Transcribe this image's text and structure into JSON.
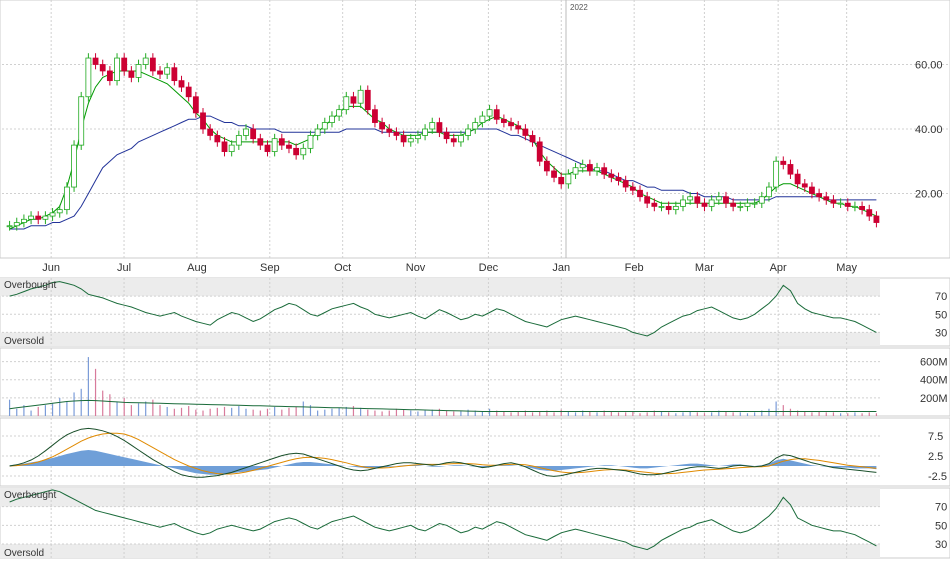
{
  "chart_data": [
    {
      "type": "candlestick",
      "year_label": "2022",
      "x_labels": [
        "Jun",
        "Jul",
        "Aug",
        "Sep",
        "Oct",
        "Nov",
        "Dec",
        "Jan",
        "Feb",
        "Mar",
        "Apr",
        "May"
      ],
      "y_ticks": [
        "60.00",
        "40.00",
        "20.00"
      ],
      "y_tick_values": [
        60,
        40,
        20
      ],
      "ylim": [
        0,
        80
      ],
      "grid": true,
      "colors": {
        "up": "#22aa22",
        "down": "#cc0033",
        "ma_short": "#009900",
        "ma_long": "#223399"
      },
      "closes": [
        10,
        11,
        12,
        13,
        12,
        13,
        14,
        15,
        22,
        35,
        50,
        62,
        60,
        58,
        55,
        62,
        58,
        56,
        60,
        62,
        58,
        57,
        59,
        55,
        53,
        50,
        45,
        40,
        38,
        36,
        33,
        35,
        38,
        40,
        37,
        35,
        33,
        37,
        35,
        34,
        32,
        34,
        38,
        40,
        42,
        44,
        46,
        50,
        48,
        52,
        46,
        42,
        40,
        39,
        38,
        36,
        37,
        38,
        40,
        42,
        39,
        37,
        36,
        38,
        40,
        42,
        44,
        46,
        43,
        42,
        41,
        40,
        38,
        36,
        30,
        27,
        25,
        23,
        26,
        28,
        29,
        27,
        28,
        26,
        25,
        24,
        22,
        21,
        19,
        17,
        16,
        16,
        15,
        16,
        18,
        19,
        17,
        16,
        18,
        19,
        17,
        16,
        16,
        17,
        17,
        19,
        22,
        30,
        29,
        26,
        23,
        22,
        20,
        19,
        18,
        17,
        17,
        16,
        16,
        15,
        13,
        11
      ],
      "ma_short": [
        9,
        10,
        11,
        12,
        12,
        13,
        14,
        16,
        22,
        30,
        40,
        48,
        53,
        56,
        57,
        58,
        58,
        58,
        58,
        57,
        56,
        55,
        54,
        52,
        50,
        48,
        45,
        43,
        40,
        38,
        37,
        36,
        36,
        36,
        36,
        36,
        36,
        36,
        36,
        36,
        35,
        36,
        37,
        39,
        41,
        43,
        45,
        47,
        47,
        47,
        45,
        43,
        42,
        40,
        39,
        38,
        38,
        38,
        39,
        39,
        39,
        38,
        38,
        38,
        39,
        40,
        42,
        43,
        44,
        43,
        42,
        41,
        39,
        37,
        33,
        30,
        28,
        26,
        26,
        27,
        27,
        27,
        27,
        26,
        25,
        24,
        23,
        22,
        20,
        19,
        18,
        17,
        17,
        17,
        17,
        17,
        17,
        17,
        17,
        17,
        17,
        17,
        17,
        17,
        17,
        18,
        20,
        22,
        23,
        23,
        22,
        21,
        20,
        19,
        18,
        17,
        17,
        16,
        16,
        15,
        14,
        13
      ],
      "ma_long": [
        9,
        9,
        9,
        10,
        10,
        10,
        11,
        11,
        12,
        13,
        16,
        20,
        24,
        28,
        30,
        32,
        33,
        34,
        36,
        37,
        38,
        39,
        40,
        41,
        42,
        43,
        43,
        44,
        44,
        43,
        42,
        42,
        41,
        41,
        40,
        40,
        40,
        40,
        39,
        39,
        39,
        39,
        39,
        39,
        39,
        39,
        39,
        40,
        40,
        40,
        40,
        40,
        39,
        39,
        39,
        39,
        39,
        39,
        39,
        39,
        39,
        39,
        39,
        39,
        39,
        40,
        40,
        40,
        40,
        39,
        38,
        38,
        37,
        36,
        35,
        34,
        33,
        32,
        31,
        30,
        29,
        28,
        27,
        27,
        26,
        25,
        24,
        24,
        23,
        22,
        22,
        21,
        21,
        21,
        21,
        20,
        20,
        19,
        19,
        19,
        19,
        18,
        18,
        18,
        18,
        18,
        18,
        19,
        19,
        19,
        19,
        19,
        19,
        19,
        18,
        18,
        18,
        18,
        18,
        18,
        18,
        18
      ]
    },
    {
      "type": "line",
      "panel": "RSI",
      "labels_top": "Overbought",
      "labels_bottom": "Oversold",
      "y_ticks": [
        "70",
        "50",
        "30"
      ],
      "ylim": [
        15,
        90
      ],
      "values": [
        70,
        72,
        75,
        78,
        80,
        82,
        85,
        86,
        84,
        82,
        78,
        72,
        70,
        68,
        65,
        62,
        60,
        58,
        55,
        52,
        50,
        48,
        50,
        52,
        48,
        45,
        42,
        40,
        38,
        44,
        48,
        52,
        50,
        46,
        42,
        45,
        50,
        55,
        58,
        62,
        60,
        55,
        50,
        48,
        52,
        56,
        58,
        60,
        62,
        58,
        55,
        50,
        48,
        46,
        48,
        50,
        52,
        48,
        45,
        50,
        55,
        52,
        48,
        44,
        46,
        50,
        48,
        52,
        56,
        54,
        50,
        46,
        42,
        40,
        38,
        36,
        40,
        44,
        46,
        48,
        46,
        44,
        42,
        40,
        38,
        36,
        34,
        30,
        28,
        26,
        30,
        36,
        40,
        44,
        48,
        50,
        54,
        56,
        58,
        54,
        50,
        46,
        44,
        46,
        50,
        56,
        62,
        70,
        82,
        76,
        62,
        56,
        52,
        50,
        48,
        46,
        46,
        44,
        42,
        38,
        34,
        30
      ]
    },
    {
      "type": "bar",
      "panel": "Volume",
      "y_ticks": [
        "600M",
        "400M",
        "200M"
      ],
      "ylim": [
        0,
        750
      ],
      "values": [
        180,
        80,
        120,
        60,
        100,
        120,
        140,
        200,
        160,
        260,
        300,
        650,
        520,
        280,
        240,
        160,
        200,
        120,
        140,
        160,
        180,
        120,
        100,
        80,
        90,
        110,
        70,
        60,
        80,
        90,
        100,
        90,
        110,
        80,
        70,
        60,
        80,
        100,
        70,
        90,
        100,
        160,
        120,
        60,
        70,
        80,
        90,
        100,
        110,
        90,
        70,
        60,
        50,
        60,
        80,
        70,
        60,
        50,
        60,
        70,
        80,
        60,
        50,
        60,
        70,
        60,
        50,
        80,
        60,
        50,
        40,
        50,
        60,
        40,
        50,
        60,
        40,
        70,
        50,
        40,
        60,
        50,
        40,
        60,
        50,
        40,
        40,
        50,
        30,
        40,
        60,
        50,
        40,
        30,
        40,
        50,
        40,
        30,
        40,
        60,
        50,
        40,
        40,
        30,
        40,
        60,
        80,
        160,
        120,
        80,
        60,
        50,
        40,
        50,
        40,
        40,
        30,
        30,
        40,
        30,
        40,
        30
      ],
      "avg_line": [
        80,
        90,
        100,
        110,
        120,
        130,
        140,
        150,
        160,
        165,
        170,
        172,
        170,
        165,
        160,
        155,
        150,
        148,
        146,
        144,
        142,
        140,
        138,
        136,
        134,
        132,
        130,
        128,
        126,
        124,
        122,
        120,
        118,
        116,
        114,
        112,
        110,
        108,
        106,
        104,
        102,
        100,
        98,
        96,
        94,
        92,
        90,
        88,
        86,
        84,
        82,
        80,
        78,
        76,
        74,
        72,
        70,
        68,
        66,
        64,
        62,
        60,
        58,
        56,
        54,
        52,
        50,
        50,
        50,
        50,
        50,
        50,
        50,
        50,
        50,
        50,
        50,
        50,
        50,
        50,
        50,
        50,
        50,
        50,
        50,
        50,
        50,
        50,
        50,
        50,
        50,
        50,
        50,
        50,
        50,
        50,
        50,
        50,
        50,
        50,
        50,
        50,
        50,
        50,
        50,
        50,
        50,
        50,
        50,
        50,
        50,
        50,
        50,
        50,
        50,
        50,
        50,
        50,
        50,
        50,
        50,
        50
      ]
    },
    {
      "type": "line",
      "panel": "MACD",
      "y_ticks": [
        "7.5",
        "2.5",
        "-2.5"
      ],
      "ylim": [
        -5,
        12
      ],
      "histogram": [
        0.2,
        0.4,
        0.6,
        0.9,
        1.2,
        1.6,
        2.0,
        2.5,
        3.0,
        3.4,
        3.8,
        4.0,
        3.8,
        3.4,
        3.0,
        2.6,
        2.2,
        1.8,
        1.4,
        1.0,
        0.6,
        0.2,
        -0.2,
        -0.6,
        -1.0,
        -1.4,
        -1.8,
        -2.0,
        -2.2,
        -2.2,
        -2.0,
        -1.8,
        -1.6,
        -1.4,
        -1.2,
        -1.0,
        -0.8,
        -0.4,
        0,
        0.4,
        0.8,
        1.0,
        1.0,
        0.8,
        0.6,
        0.4,
        0.2,
        0,
        -0.2,
        -0.4,
        -0.6,
        -0.6,
        -0.4,
        -0.2,
        0,
        0.2,
        0.2,
        0.2,
        0,
        -0.2,
        -0.2,
        0,
        0.2,
        0.2,
        0,
        -0.2,
        -0.4,
        -0.2,
        0,
        0.2,
        0.2,
        0,
        -0.2,
        -0.6,
        -1.0,
        -1.2,
        -1.2,
        -1.0,
        -0.8,
        -0.6,
        -0.4,
        -0.2,
        0,
        0.2,
        0.2,
        0,
        -0.2,
        -0.4,
        -0.6,
        -0.6,
        -0.4,
        -0.2,
        0,
        0.2,
        0.4,
        0.6,
        0.6,
        0.4,
        0.2,
        0,
        0.2,
        0.4,
        0.4,
        0.2,
        0,
        0.2,
        0.6,
        1.4,
        1.8,
        1.4,
        1.0,
        0.6,
        0.2,
        0,
        -0.2,
        -0.4,
        -0.4,
        -0.4,
        -0.6,
        -0.6,
        -0.6,
        -0.8
      ],
      "macd": [
        0,
        0.3,
        0.8,
        1.5,
        2.5,
        3.8,
        5.2,
        6.6,
        7.8,
        8.6,
        9.2,
        9.4,
        9.2,
        8.8,
        8.2,
        7.4,
        6.4,
        5.2,
        4.0,
        2.8,
        1.6,
        0.6,
        -0.4,
        -1.4,
        -2.2,
        -2.6,
        -2.8,
        -2.8,
        -2.6,
        -2.4,
        -2.0,
        -1.6,
        -1.0,
        -0.4,
        0.2,
        0.8,
        1.4,
        2.0,
        2.6,
        3.0,
        3.2,
        3.0,
        2.4,
        1.8,
        1.2,
        0.6,
        0,
        -0.6,
        -1.0,
        -1.2,
        -1.0,
        -0.6,
        -0.2,
        0.2,
        0.6,
        0.8,
        0.8,
        0.6,
        0.4,
        0.2,
        0.4,
        0.8,
        1.0,
        0.8,
        0.4,
        0,
        -0.4,
        -0.2,
        0.2,
        0.6,
        0.8,
        0.4,
        -0.2,
        -1.0,
        -1.8,
        -2.4,
        -2.6,
        -2.4,
        -2.0,
        -1.6,
        -1.2,
        -0.8,
        -0.6,
        -0.6,
        -0.8,
        -1.0,
        -1.2,
        -1.6,
        -2.0,
        -2.2,
        -2.2,
        -2.0,
        -1.6,
        -1.2,
        -0.8,
        -0.4,
        -0.2,
        -0.2,
        -0.4,
        -0.6,
        -0.4,
        0,
        0.2,
        0,
        -0.2,
        0,
        0.6,
        2.0,
        2.8,
        2.6,
        2.0,
        1.4,
        0.8,
        0.4,
        0,
        -0.4,
        -0.6,
        -0.8,
        -1.0,
        -1.2,
        -1.4,
        -1.6
      ],
      "signal": [
        0,
        0.1,
        0.3,
        0.6,
        1.0,
        1.6,
        2.3,
        3.2,
        4.2,
        5.2,
        6.2,
        7.0,
        7.6,
        8.0,
        8.2,
        8.2,
        8.0,
        7.4,
        6.6,
        5.6,
        4.6,
        3.6,
        2.6,
        1.6,
        0.8,
        0,
        -0.6,
        -1.2,
        -1.6,
        -1.9,
        -2.0,
        -2.0,
        -1.8,
        -1.5,
        -1.1,
        -0.6,
        -0.1,
        0.4,
        0.9,
        1.4,
        1.8,
        2.1,
        2.2,
        2.1,
        1.9,
        1.6,
        1.2,
        0.8,
        0.3,
        -0.1,
        -0.4,
        -0.5,
        -0.5,
        -0.4,
        -0.2,
        0,
        0.2,
        0.3,
        0.4,
        0.4,
        0.4,
        0.5,
        0.6,
        0.6,
        0.6,
        0.5,
        0.3,
        0.2,
        0.2,
        0.3,
        0.4,
        0.4,
        0.3,
        0,
        -0.4,
        -0.8,
        -1.2,
        -1.5,
        -1.7,
        -1.7,
        -1.6,
        -1.4,
        -1.2,
        -1.0,
        -0.9,
        -0.9,
        -1.0,
        -1.2,
        -1.4,
        -1.6,
        -1.8,
        -1.9,
        -1.9,
        -1.8,
        -1.6,
        -1.4,
        -1.2,
        -1.0,
        -0.9,
        -0.8,
        -0.7,
        -0.6,
        -0.4,
        -0.3,
        -0.2,
        -0.2,
        0,
        0.6,
        1.2,
        1.6,
        1.8,
        1.8,
        1.6,
        1.4,
        1.1,
        0.8,
        0.5,
        0.2,
        0,
        -0.2,
        -0.4,
        -0.6
      ]
    },
    {
      "type": "line",
      "panel": "Stochastic",
      "labels_top": "Overbought",
      "labels_bottom": "Oversold",
      "y_ticks": [
        "70",
        "50",
        "30"
      ],
      "ylim": [
        15,
        90
      ],
      "values": [
        75,
        78,
        80,
        82,
        84,
        86,
        88,
        86,
        82,
        78,
        74,
        70,
        66,
        64,
        62,
        60,
        58,
        56,
        54,
        52,
        50,
        48,
        50,
        52,
        48,
        45,
        42,
        40,
        42,
        46,
        48,
        50,
        48,
        46,
        44,
        46,
        50,
        54,
        56,
        58,
        56,
        52,
        48,
        46,
        50,
        54,
        56,
        58,
        60,
        56,
        52,
        48,
        46,
        44,
        46,
        48,
        50,
        46,
        44,
        48,
        52,
        50,
        46,
        42,
        44,
        48,
        46,
        50,
        54,
        52,
        48,
        44,
        40,
        38,
        36,
        34,
        38,
        42,
        44,
        46,
        44,
        42,
        40,
        38,
        36,
        34,
        32,
        28,
        26,
        24,
        28,
        34,
        38,
        42,
        46,
        48,
        52,
        54,
        56,
        52,
        48,
        44,
        42,
        44,
        48,
        54,
        60,
        68,
        80,
        72,
        58,
        54,
        50,
        48,
        46,
        44,
        44,
        42,
        40,
        36,
        32,
        28
      ]
    }
  ]
}
